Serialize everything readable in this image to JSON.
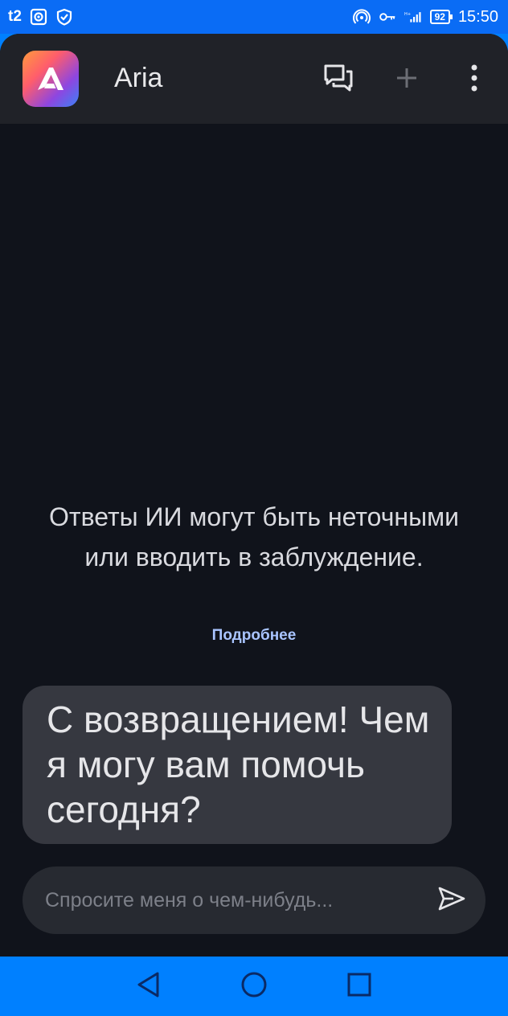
{
  "status_bar": {
    "carrier": "t2",
    "battery": "92",
    "time": "15:50",
    "icons": [
      "screen-record-icon",
      "shield-icon",
      "hotspot-icon",
      "vpn-key-icon",
      "signal-icon"
    ]
  },
  "header": {
    "title": "Aria",
    "logo_icon": "aria-logo-icon",
    "actions": [
      "chats-icon",
      "plus-icon",
      "more-vertical-icon"
    ]
  },
  "main": {
    "disclaimer": "Ответы ИИ могут быть неточными или вводить в заблуждение.",
    "learn_more": "Подробнее",
    "assistant_message": "С возвращением! Чем я могу вам помочь сегодня?"
  },
  "composer": {
    "placeholder": "Спросите меня о чем-нибудь...",
    "value": "",
    "send_icon": "send-icon"
  },
  "nav_bar": {
    "buttons": [
      "back-icon",
      "home-icon",
      "recents-icon"
    ]
  },
  "colors": {
    "status_bar_bg": "#0a6cf5",
    "nav_bar_bg": "#0080ff",
    "app_bg": "#10131b",
    "topbar_bg": "#202228",
    "bubble_bg": "#363840",
    "composer_bg": "#272a31",
    "link": "#a9c4ff"
  }
}
